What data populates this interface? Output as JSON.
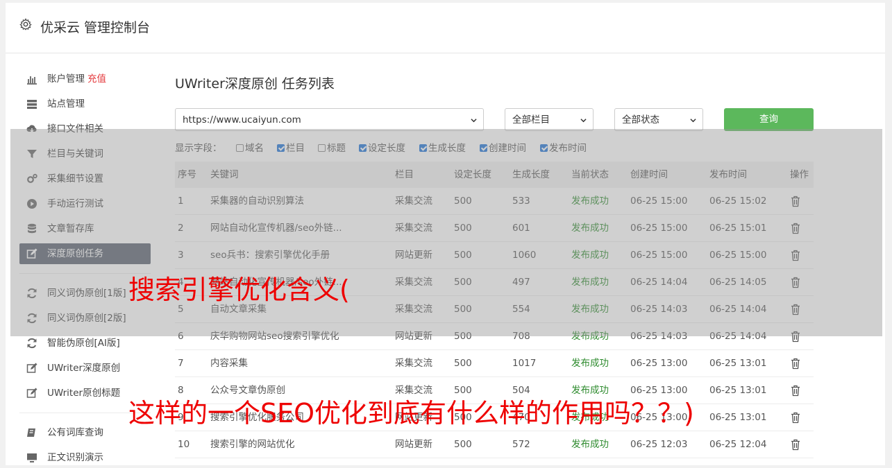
{
  "header": {
    "title": "优采云 管理控制台"
  },
  "sidebar": {
    "items": [
      {
        "label": "账户管理",
        "extra": "充值",
        "icon": "bar-chart-icon",
        "active": false
      },
      {
        "label": "站点管理",
        "extra": "",
        "icon": "server-icon",
        "active": false
      },
      {
        "label": "接口文件相关",
        "extra": "",
        "icon": "cloud-download-icon",
        "active": false
      },
      {
        "label": "栏目与关键词",
        "extra": "",
        "icon": "filter-icon",
        "active": false
      },
      {
        "label": "采集细节设置",
        "extra": "",
        "icon": "gears-icon",
        "active": false
      },
      {
        "label": "手动运行测试",
        "extra": "",
        "icon": "play-circle-icon",
        "active": false
      },
      {
        "label": "文章暂存库",
        "extra": "",
        "icon": "database-icon",
        "active": false
      },
      {
        "label": "深度原创任务",
        "extra": "",
        "icon": "edit-icon",
        "active": true
      },
      {
        "label": "同义词伪原创[1版]",
        "extra": "",
        "icon": "refresh-icon",
        "active": false
      },
      {
        "label": "同义词伪原创[2版]",
        "extra": "",
        "icon": "refresh-icon",
        "active": false
      },
      {
        "label": "智能伪原创[AI版]",
        "extra": "",
        "icon": "refresh-icon",
        "active": false
      },
      {
        "label": "UWriter深度原创",
        "extra": "",
        "icon": "edit-icon",
        "active": false
      },
      {
        "label": "UWriter原创标题",
        "extra": "",
        "icon": "edit-icon",
        "active": false
      },
      {
        "label": "公有词库查询",
        "extra": "",
        "icon": "book-icon",
        "active": false
      },
      {
        "label": "正文识别演示",
        "extra": "",
        "icon": "monitor-icon",
        "active": false
      }
    ]
  },
  "main": {
    "title": "UWriter深度原创 任务列表",
    "site_select": "https://www.ucaiyun.com",
    "column_select": "全部栏目",
    "status_select": "全部状态",
    "query_label": "查询",
    "fields_label": "显示字段：",
    "fields": [
      {
        "label": "域名",
        "checked": false
      },
      {
        "label": "栏目",
        "checked": true
      },
      {
        "label": "标题",
        "checked": false
      },
      {
        "label": "设定长度",
        "checked": true
      },
      {
        "label": "生成长度",
        "checked": true
      },
      {
        "label": "创建时间",
        "checked": true
      },
      {
        "label": "发布时间",
        "checked": true
      }
    ]
  },
  "table": {
    "headers": [
      "序号",
      "关键词",
      "栏目",
      "设定长度",
      "生成长度",
      "当前状态",
      "创建时间",
      "发布时间",
      "操作"
    ],
    "rows": [
      {
        "no": "1",
        "keyword": "采集器的自动识别算法",
        "column": "采集交流",
        "set": "500",
        "gen": "533",
        "status": "发布成功",
        "created": "06-25 15:00",
        "published": "06-25 15:02"
      },
      {
        "no": "2",
        "keyword": "网站自动化宣传机器/seo外链...",
        "column": "采集交流",
        "set": "500",
        "gen": "601",
        "status": "发布成功",
        "created": "06-25 15:00",
        "published": "06-25 15:01"
      },
      {
        "no": "3",
        "keyword": "seo兵书：搜索引擎优化手册",
        "column": "网站更新",
        "set": "500",
        "gen": "1060",
        "status": "发布成功",
        "created": "06-25 15:00",
        "published": "06-25 15:00"
      },
      {
        "no": "4",
        "keyword": "网站自动化宣传机器/seo外链...",
        "column": "采集交流",
        "set": "500",
        "gen": "497",
        "status": "发布成功",
        "created": "06-25 14:04",
        "published": "06-25 14:05"
      },
      {
        "no": "5",
        "keyword": "自动文章采集",
        "column": "采集交流",
        "set": "500",
        "gen": "554",
        "status": "发布成功",
        "created": "06-25 14:03",
        "published": "06-25 14:04"
      },
      {
        "no": "6",
        "keyword": "庆华购物网站seo搜索引擎优化",
        "column": "网站更新",
        "set": "500",
        "gen": "708",
        "status": "发布成功",
        "created": "06-25 14:03",
        "published": "06-25 14:04"
      },
      {
        "no": "7",
        "keyword": "内容采集",
        "column": "采集交流",
        "set": "500",
        "gen": "1017",
        "status": "发布成功",
        "created": "06-25 13:00",
        "published": "06-25 13:01"
      },
      {
        "no": "8",
        "keyword": "公众号文章伪原创",
        "column": "采集交流",
        "set": "500",
        "gen": "504",
        "status": "发布成功",
        "created": "06-25 13:00",
        "published": "06-25 13:01"
      },
      {
        "no": "9",
        "keyword": "搜索引擎优化服务公司",
        "column": "网站更新",
        "set": "500",
        "gen": "470",
        "status": "发布成功",
        "created": "06-25 13:00",
        "published": "06-25 13:01"
      },
      {
        "no": "10",
        "keyword": "搜索引擎的网站优化",
        "column": "网站更新",
        "set": "500",
        "gen": "572",
        "status": "发布成功",
        "created": "06-25 12:03",
        "published": "06-25 12:04"
      }
    ]
  },
  "overlay_text": {
    "line1": "搜索引擎优化含义(",
    "line2": "这样的一个SEO优化到底有什么样的作用吗？？)"
  },
  "colors": {
    "accent_green": "#5cb85c",
    "status_green": "#2e8b2e",
    "overlay_red": "#ee0000",
    "active_bg": "#5a6270"
  }
}
